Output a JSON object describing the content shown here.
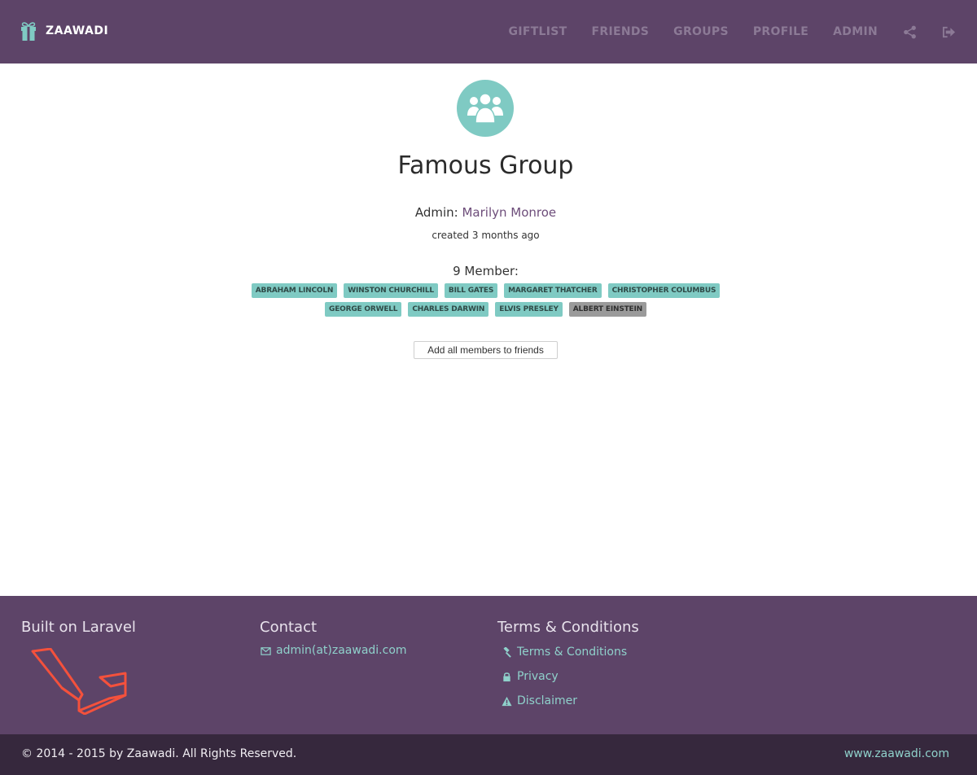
{
  "navbar": {
    "brand_icon": "gift-icon",
    "brand_name": "ZAAWADI",
    "items": [
      {
        "label": "GIFTLIST"
      },
      {
        "label": "FRIENDS"
      },
      {
        "label": "GROUPS"
      },
      {
        "label": "PROFILE"
      },
      {
        "label": "ADMIN"
      }
    ],
    "share_icon": "share-icon",
    "logout_icon": "logout-icon"
  },
  "group": {
    "avatar_icon": "users-icon",
    "title": "Famous Group",
    "admin_label": "Admin:",
    "admin_name": "Marilyn Monroe",
    "created": "created 3 months ago",
    "members_title": "9 Member:",
    "members_row1": [
      "ABRAHAM LINCOLN",
      "WINSTON CHURCHILL",
      "BILL GATES",
      "MARGARET THATCHER",
      "CHRISTOPHER COLUMBUS"
    ],
    "members_row2": [
      "GEORGE ORWELL",
      "CHARLES DARWIN",
      "ELVIS PRESLEY",
      "ALBERT EINSTEIN"
    ],
    "add_button": "Add all members to friends"
  },
  "footer": {
    "col1_title": "Built on Laravel",
    "col2_title": "Contact",
    "contact_email": "admin(at)zaawadi.com",
    "col3_title": "Terms & Conditions",
    "terms_links": [
      {
        "label": "Terms & Conditions",
        "icon": "gavel-icon"
      },
      {
        "label": "Privacy",
        "icon": "lock-icon"
      },
      {
        "label": "Disclaimer",
        "icon": "warning-icon"
      }
    ]
  },
  "bottom": {
    "copyright": "© 2014 - 2015 by Zaawadi. All Rights Reserved.",
    "site_link": "www.zaawadi.com"
  },
  "colors": {
    "primary": "#5d4468",
    "accent": "#7fcac3",
    "dark": "#36283d",
    "laravel": "#f4513c"
  }
}
